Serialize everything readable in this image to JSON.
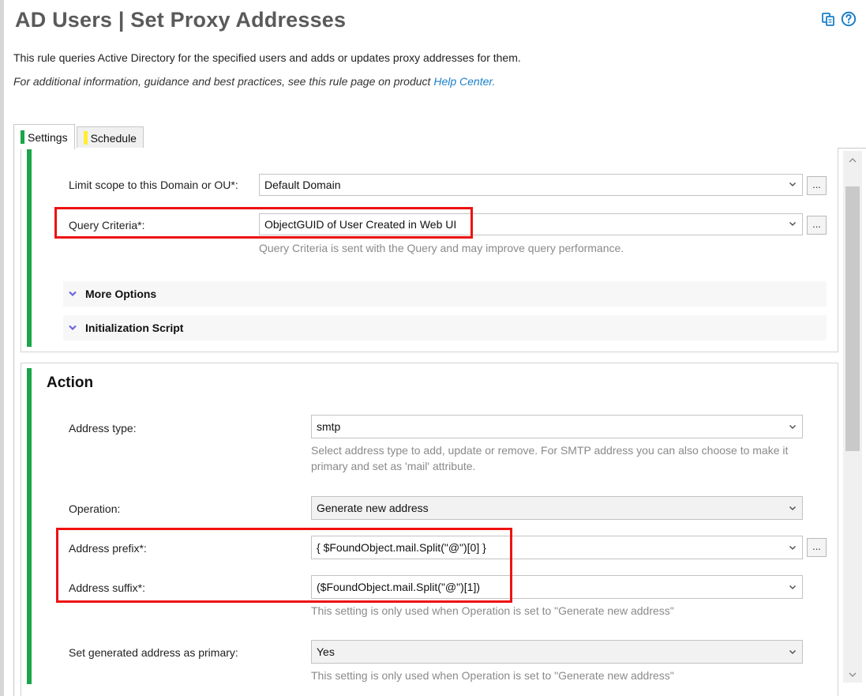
{
  "header": {
    "title": "AD Users | Set Proxy Addresses",
    "copy_icon": "copy-icon",
    "help_icon": "help-icon"
  },
  "description": {
    "line1": "This rule queries Active Directory for the specified users and adds or updates proxy addresses for them.",
    "line2_prefix": "For additional information, guidance and best practices, see this rule page on product ",
    "help_link": "Help Center."
  },
  "tabs": [
    {
      "label": "Settings",
      "color": "#1aa54a",
      "active": true
    },
    {
      "label": "Schedule",
      "color": "#ffee33",
      "active": false
    }
  ],
  "scope": {
    "limit_label": "Limit scope to this Domain or OU*:",
    "limit_value": "Default Domain",
    "criteria_label": "Query Criteria*:",
    "criteria_value": "ObjectGUID of User Created in Web UI",
    "criteria_hint": "Query Criteria is sent with the Query and may improve query performance.",
    "browse": "...",
    "more_options": "More Options",
    "init_script": "Initialization Script"
  },
  "action": {
    "title": "Action",
    "address_type_label": "Address type:",
    "address_type_value": "smtp",
    "address_type_hint": "Select address type to add, update or remove. For SMTP address you can also choose to make it primary and set as 'mail' attribute.",
    "operation_label": "Operation:",
    "operation_value": "Generate new address",
    "prefix_label": "Address prefix*:",
    "prefix_value": "{ $FoundObject.mail.Split(\"@\")[0] }",
    "suffix_label": "Address suffix*:",
    "suffix_value": "($FoundObject.mail.Split(\"@\")[1])",
    "suffix_hint": "This setting is only used when Operation is set to \"Generate new address\"",
    "primary_label": "Set generated address as primary:",
    "primary_value": "Yes",
    "primary_hint": "This setting is only used when Operation is set to \"Generate new address\"",
    "browse": "..."
  },
  "colors": {
    "accent_green": "#1aa54a",
    "highlight_red": "#ee1111",
    "link_blue": "#1a7fc9",
    "icon_blue": "#1a7fc9"
  }
}
